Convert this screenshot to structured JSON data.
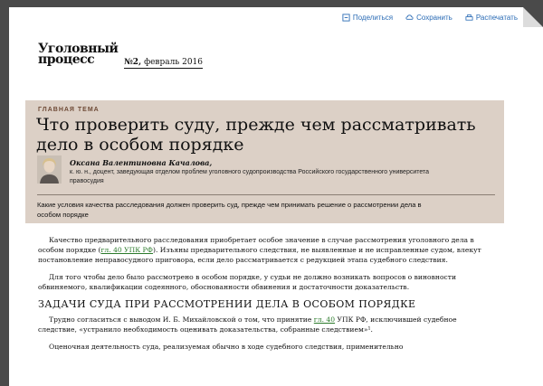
{
  "toolbar": {
    "publish_label": "Поделиться",
    "save_label": "Сохранить",
    "print_label": "Распечатать"
  },
  "masthead": {
    "logo_line1": "Уголовный",
    "logo_line2": "процесс",
    "issue_number": "№2,",
    "issue_date": "февраль 2016"
  },
  "lead": {
    "kicker": "ГЛАВНАЯ ТЕМА",
    "title": "Что проверить суду, прежде чем рассматривать дело в особом порядке",
    "author_name": "Оксана Валентиновна Качалова,",
    "author_info": "к. ю. н., доцент, заведующая отделом проблем уголовного судопроизводства Российского государственного университета правосудия",
    "summary": "Какие условия качества расследования должен проверить суд, прежде чем принимать решение о рассмотрении дела в особом порядке"
  },
  "article": {
    "p1_before": "Качество предварительного расследования приобретает особое значение в случае рассмотрения уголовного дела в особом порядке (",
    "p1_link": "гл. 40 УПК РФ",
    "p1_after": "). Изъяны предварительного следствия, не выявленные и не исправленные судом, влекут постановление неправосудного приговора, если дело рассматривается с редукцией этапа судебного следствия.",
    "p2": "Для того чтобы дело было рассмотрено в особом порядке, у судьи не должно возникать вопросов о виновности обвиняемого, квалификации содеянного, обоснованности обвинения и достаточности доказательств.",
    "h2": "ЗАДАЧИ СУДА ПРИ РАССМОТРЕНИИ ДЕЛА В ОСОБОМ ПОРЯДКЕ",
    "p3_before": "Трудно согласиться с выводом И. Б. Михайловской о том, что принятие ",
    "p3_link": "гл. 40",
    "p3_after": " УПК РФ, исключившей судебное следствие, «устранило необходимость оценивать доказательства, собранные следствием»¹.",
    "p4": "Оценочная деятельность суда, реализуемая обычно в ходе судебного следствия, применительно"
  }
}
